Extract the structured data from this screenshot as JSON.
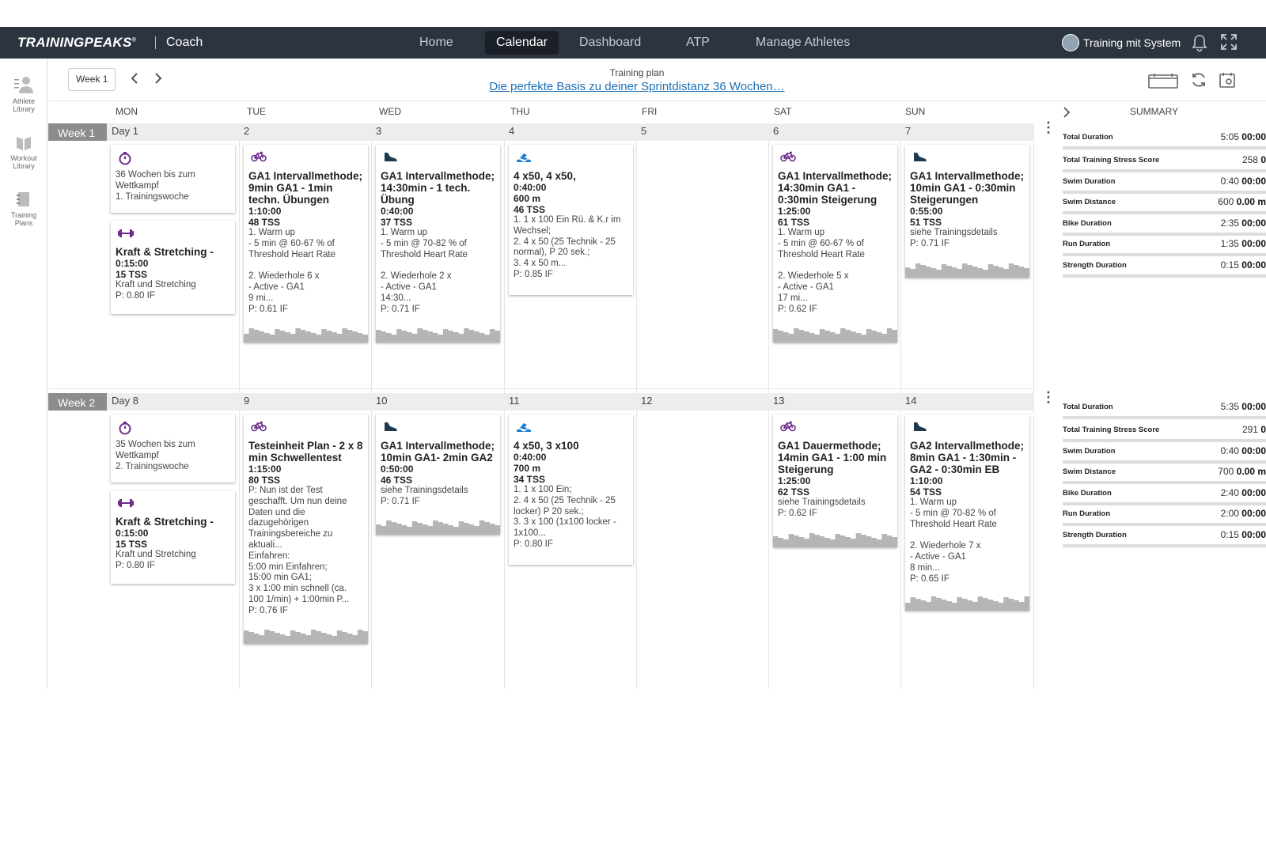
{
  "app": {
    "logo": "TRAININGPEAKS",
    "logo_mark": "®",
    "product": "Coach"
  },
  "nav": {
    "items": [
      "Home",
      "Calendar",
      "Dashboard",
      "ATP",
      "Manage Athletes"
    ],
    "active": "Calendar"
  },
  "user": {
    "name": "Training mit System"
  },
  "sidebar": {
    "items": [
      {
        "label": "Athlete Library",
        "icon": "athlete-icon"
      },
      {
        "label": "Workout Library",
        "icon": "book-icon"
      },
      {
        "label": "Training Plans",
        "icon": "plan-icon"
      }
    ]
  },
  "toolbar": {
    "week_button": "Week 1",
    "plan_label": "Training plan",
    "plan_title": "Die perfekte Basis zu deiner Sprintdistanz 36 Wochen…"
  },
  "days": [
    "MON",
    "TUE",
    "WED",
    "THU",
    "FRI",
    "SAT",
    "SUN"
  ],
  "summary_header": "SUMMARY",
  "weeks": [
    {
      "label": "Week 1",
      "day_numbers": [
        "Day 1",
        "2",
        "3",
        "4",
        "5",
        "6",
        "7"
      ],
      "cards": [
        {
          "col": 0,
          "slot": 0,
          "type": "event",
          "icon": "stopwatch-icon",
          "title": "",
          "bold": [],
          "lines": "36 Wochen bis zum\nWettkampf\n1. Trainingswoche",
          "graph": false
        },
        {
          "col": 0,
          "slot": 1,
          "type": "strength",
          "icon": "dumbbell-icon",
          "title": "Kraft & Stretching -",
          "bold": [
            "0:15:00",
            "15 TSS"
          ],
          "lines": "Kraft und Stretching\nP: 0.80 IF",
          "graph": false
        },
        {
          "col": 1,
          "slot": 0,
          "type": "bike",
          "icon": "bike-icon",
          "title": "GA1 Intervallmethode; 9min GA1 - 1min techn. Übungen",
          "bold": [
            "1:10:00",
            "48 TSS"
          ],
          "lines": "1. Warm up\n- 5 min @ 60-67 % of\nThreshold Heart Rate\n\n2. Wiederhole 6 x\n- Active - GA1\n9 mi...\nP: 0.61 IF",
          "graph": true
        },
        {
          "col": 2,
          "slot": 0,
          "type": "run",
          "icon": "shoe-icon",
          "title": "GA1 Intervallmethode; 14:30min - 1 tech. Übung",
          "bold": [
            "0:40:00",
            "37 TSS"
          ],
          "lines": "1. Warm up\n- 5 min @ 70-82 % of\nThreshold Heart Rate\n\n2. Wiederhole 2 x\n- Active - GA1\n14:30...\nP: 0.71 IF",
          "graph": true
        },
        {
          "col": 3,
          "slot": 0,
          "type": "swim",
          "icon": "swim-icon",
          "title": "4 x50, 4 x50,",
          "bold": [
            "0:40:00",
            "600 m",
            "46 TSS"
          ],
          "lines": "1. 1 x 100 Ein Rü. & K.r im\nWechsel;\n2. 4 x 50 (25 Technik - 25\nnormal), P 20 sek.;\n3. 4 x 50 m...\nP: 0.85 IF",
          "graph": false
        },
        {
          "col": 5,
          "slot": 0,
          "type": "bike",
          "icon": "bike-icon",
          "title": "GA1 Intervallmethode; 14:30min GA1 - 0:30min Steigerung",
          "bold": [
            "1:25:00",
            "61 TSS"
          ],
          "lines": "1. Warm up\n- 5 min @ 60-67 % of\nThreshold Heart Rate\n\n2. Wiederhole 5 x\n- Active - GA1\n17 mi...\nP: 0.62 IF",
          "graph": true
        },
        {
          "col": 6,
          "slot": 0,
          "type": "run",
          "icon": "shoe-icon",
          "title": "GA1 Intervallmethode; 10min GA1 - 0:30min Steigerungen",
          "bold": [
            "0:55:00",
            "51 TSS"
          ],
          "lines": "siehe Trainingsdetails\nP: 0.71 IF",
          "graph": true
        }
      ],
      "summary": [
        {
          "label": "Total Duration",
          "light": "5:05",
          "value": "00:00"
        },
        {
          "label": "Total Training Stress Score",
          "light": "258",
          "value": "0"
        },
        {
          "label": "Swim Duration",
          "light": "0:40",
          "value": "00:00"
        },
        {
          "label": "Swim Distance",
          "light": "600",
          "value": "0.00 m"
        },
        {
          "label": "Bike Duration",
          "light": "2:35",
          "value": "00:00"
        },
        {
          "label": "Run Duration",
          "light": "1:35",
          "value": "00:00"
        },
        {
          "label": "Strength Duration",
          "light": "0:15",
          "value": "00:00"
        }
      ]
    },
    {
      "label": "Week 2",
      "day_numbers": [
        "Day 8",
        "9",
        "10",
        "11",
        "12",
        "13",
        "14"
      ],
      "cards": [
        {
          "col": 0,
          "slot": 0,
          "type": "event",
          "icon": "stopwatch-icon",
          "title": "",
          "bold": [],
          "lines": "35 Wochen bis zum\nWettkampf\n2. Trainingswoche",
          "graph": false
        },
        {
          "col": 0,
          "slot": 1,
          "type": "strength",
          "icon": "dumbbell-icon",
          "title": "Kraft & Stretching -",
          "bold": [
            "0:15:00",
            "15 TSS"
          ],
          "lines": "Kraft und Stretching\nP: 0.80 IF",
          "graph": false
        },
        {
          "col": 1,
          "slot": 0,
          "type": "bike",
          "icon": "bike-icon",
          "title": "Testeinheit Plan - 2 x 8 min Schwellentest",
          "bold": [
            "1:15:00",
            "80 TSS"
          ],
          "lines": "P: Nun ist der Test\ngeschafft. Um nun deine\nDaten und die\ndazugehörigen\nTrainingsbereiche zu\naktuali...\nEinfahren:\n5:00 min Einfahren;\n15:00 min GA1;\n3 x 1:00 min schnell (ca.\n100 1/min) + 1:00min P...\nP: 0.76 IF",
          "graph": true
        },
        {
          "col": 2,
          "slot": 0,
          "type": "run",
          "icon": "shoe-icon",
          "title": "GA1 Intervallmethode; 10min GA1- 2min GA2",
          "bold": [
            "0:50:00",
            "46 TSS"
          ],
          "lines": "siehe Trainingsdetails\nP: 0.71 IF",
          "graph": true
        },
        {
          "col": 3,
          "slot": 0,
          "type": "swim",
          "icon": "swim-icon",
          "title": "4 x50, 3 x100",
          "bold": [
            "0:40:00",
            "700 m",
            "34 TSS"
          ],
          "lines": "1. 1 x 100 Ein;\n2. 4 x 50 (25 Technik - 25\nlocker) P 20 sek.;\n3. 3 x 100 (1x100 locker -\n1x100...\nP: 0.80 IF",
          "graph": false
        },
        {
          "col": 5,
          "slot": 0,
          "type": "bike",
          "icon": "bike-icon",
          "title": "GA1 Dauermethode; 14min GA1 - 1:00 min Steigerung",
          "bold": [
            "1:25:00",
            "62 TSS"
          ],
          "lines": "siehe Trainingsdetails\nP: 0.62 IF",
          "graph": true
        },
        {
          "col": 6,
          "slot": 0,
          "type": "run",
          "icon": "shoe-icon",
          "title": "GA2 Intervallmethode; 8min GA1 - 1:30min - GA2 - 0:30min EB",
          "bold": [
            "1:10:00",
            "54 TSS"
          ],
          "lines": "1. Warm up\n- 5 min @ 70-82 % of\nThreshold Heart Rate\n\n2. Wiederhole 7 x\n- Active - GA1\n8 min...\nP: 0.65 IF",
          "graph": true
        }
      ],
      "summary": [
        {
          "label": "Total Duration",
          "light": "5:35",
          "value": "00:00"
        },
        {
          "label": "Total Training Stress Score",
          "light": "291",
          "value": "0"
        },
        {
          "label": "Swim Duration",
          "light": "0:40",
          "value": "00:00"
        },
        {
          "label": "Swim Distance",
          "light": "700",
          "value": "0.00 m"
        },
        {
          "label": "Bike Duration",
          "light": "2:40",
          "value": "00:00"
        },
        {
          "label": "Run Duration",
          "light": "2:00",
          "value": "00:00"
        },
        {
          "label": "Strength Duration",
          "light": "0:15",
          "value": "00:00"
        }
      ]
    }
  ],
  "colors": {
    "topbar": "#2c3440",
    "link": "#1b6fb5",
    "bike": "#6b2d8c",
    "run": "#1d3a4f",
    "swim": "#1f7fd1",
    "event": "#6b2d8c",
    "strength": "#6b2d8c",
    "graph": "#b5b5b5"
  }
}
